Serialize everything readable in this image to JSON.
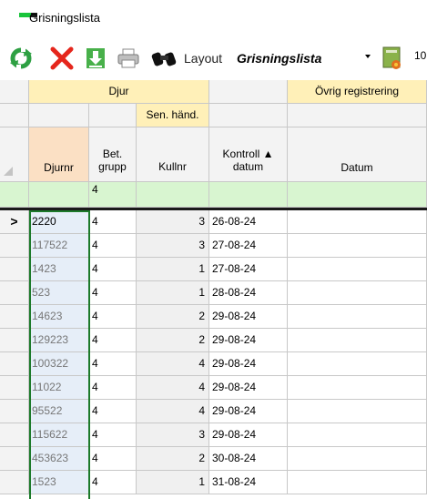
{
  "window": {
    "title": "Grisningslista"
  },
  "toolbar": {
    "layout_label": "Layout",
    "layout_value": "Grisningslista",
    "extra_number": "10",
    "buttons": [
      {
        "name": "refresh-icon"
      },
      {
        "name": "delete-icon"
      },
      {
        "name": "download-icon"
      },
      {
        "name": "print-icon"
      },
      {
        "name": "binoculars-icon"
      },
      {
        "name": "dropdown-arrow-icon"
      },
      {
        "name": "report-icon"
      }
    ]
  },
  "grid": {
    "group_headers": {
      "djur": "Djur",
      "ovrig": "Övrig registrering"
    },
    "sub_header": {
      "sen_hand": "Sen. händ."
    },
    "columns": {
      "djurnr": "Djurnr",
      "bet_grupp_1": "Bet.",
      "bet_grupp_2": "grupp",
      "kullnr": "Kullnr",
      "kontroll_1": "Kontroll ▲",
      "kontroll_2": "datum",
      "datum": "Datum"
    },
    "filter_row": {
      "bet_grupp": "4"
    },
    "current_row_marker": ">",
    "rows": [
      {
        "djurnr": "2220",
        "grupp": "4",
        "kullnr": "3",
        "datum": "26-08-24"
      },
      {
        "djurnr": "117522",
        "grupp": "4",
        "kullnr": "3",
        "datum": "27-08-24"
      },
      {
        "djurnr": "1423",
        "grupp": "4",
        "kullnr": "1",
        "datum": "27-08-24"
      },
      {
        "djurnr": "523",
        "grupp": "4",
        "kullnr": "1",
        "datum": "28-08-24"
      },
      {
        "djurnr": "14623",
        "grupp": "4",
        "kullnr": "2",
        "datum": "29-08-24"
      },
      {
        "djurnr": "129223",
        "grupp": "4",
        "kullnr": "2",
        "datum": "29-08-24"
      },
      {
        "djurnr": "100322",
        "grupp": "4",
        "kullnr": "4",
        "datum": "29-08-24"
      },
      {
        "djurnr": "11022",
        "grupp": "4",
        "kullnr": "4",
        "datum": "29-08-24"
      },
      {
        "djurnr": "95522",
        "grupp": "4",
        "kullnr": "4",
        "datum": "29-08-24"
      },
      {
        "djurnr": "115622",
        "grupp": "4",
        "kullnr": "3",
        "datum": "29-08-24"
      },
      {
        "djurnr": "453623",
        "grupp": "4",
        "kullnr": "2",
        "datum": "30-08-24"
      },
      {
        "djurnr": "1523",
        "grupp": "4",
        "kullnr": "1",
        "datum": "31-08-24"
      }
    ]
  }
}
